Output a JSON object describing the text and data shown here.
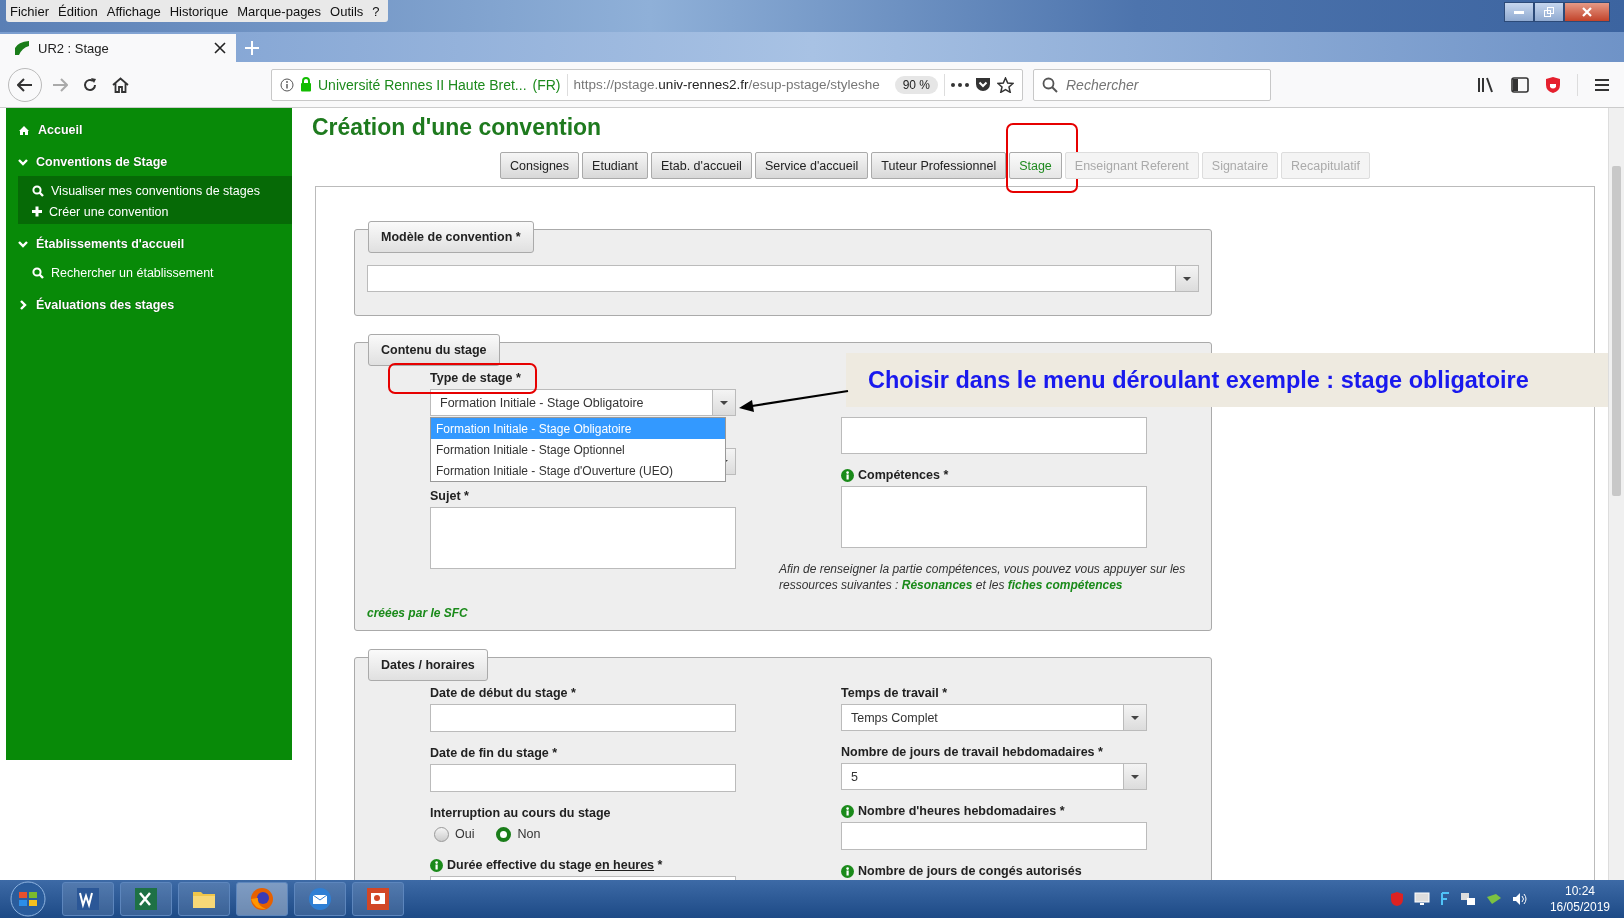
{
  "menu_bar": [
    "Fichier",
    "Édition",
    "Affichage",
    "Historique",
    "Marque-pages",
    "Outils",
    "?"
  ],
  "browser_tab": {
    "title": "UR2 : Stage"
  },
  "address_bar": {
    "site": "Université Rennes II Haute Bret...",
    "country": "(FR)",
    "url_prefix": "https://pstage.",
    "url_domain": "univ-rennes2.fr",
    "url_path": "/esup-pstage/styleshe",
    "zoom": "90 %"
  },
  "search": {
    "placeholder": "Rechercher"
  },
  "sidebar": {
    "items": [
      {
        "kind": "home",
        "label": "Accueil"
      },
      {
        "kind": "section",
        "label": "Conventions de Stage",
        "expanded": true,
        "selected": true,
        "children": [
          {
            "kind": "search",
            "label": "Visualiser mes conventions de stages"
          },
          {
            "kind": "add",
            "label": "Créer une convention"
          }
        ]
      },
      {
        "kind": "section",
        "label": "Établissements d'accueil",
        "expanded": true,
        "selected": false,
        "children": [
          {
            "kind": "search",
            "label": "Rechercher un établissement"
          }
        ]
      },
      {
        "kind": "section",
        "label": "Évaluations des stages",
        "expanded": false
      }
    ]
  },
  "page_title": "Création d'une convention",
  "tabs": [
    {
      "label": "Consignes",
      "selected": false,
      "disabled": false,
      "highlighted": false
    },
    {
      "label": "Etudiant",
      "selected": false,
      "disabled": false,
      "highlighted": false
    },
    {
      "label": "Etab. d'accueil",
      "selected": false,
      "disabled": false,
      "highlighted": false
    },
    {
      "label": "Service d'accueil",
      "selected": false,
      "disabled": false,
      "highlighted": false
    },
    {
      "label": "Tuteur Professionnel",
      "selected": false,
      "disabled": false,
      "highlighted": false
    },
    {
      "label": "Stage",
      "selected": true,
      "disabled": false,
      "highlighted": true
    },
    {
      "label": "Enseignant Referent",
      "selected": false,
      "disabled": true,
      "highlighted": false
    },
    {
      "label": "Signataire",
      "selected": false,
      "disabled": true,
      "highlighted": false
    },
    {
      "label": "Recapitulatif",
      "selected": false,
      "disabled": true,
      "highlighted": false
    }
  ],
  "sections": [
    {
      "legend": "Modèle de convention *",
      "fields": [
        {
          "kind": "select"
        }
      ]
    },
    {
      "legend": "Contenu du stage",
      "columns": [
        [
          {
            "kind": "select",
            "label": "Type de stage *",
            "highlighted": true,
            "value": "Formation Initiale - Stage Obligatoire",
            "open": true,
            "options": [
              {
                "label": "Formation Initiale - Stage Obligatoire",
                "selected": true
              },
              {
                "label": "Formation Initiale - Stage Optionnel",
                "selected": false
              },
              {
                "label": "Formation Initiale - Stage d'Ouverture (UEO)",
                "selected": false
              }
            ]
          },
          {
            "kind": "select"
          },
          {
            "kind": "textarea",
            "label": "Sujet *"
          }
        ],
        [
          {
            "kind": "textarea"
          },
          {
            "kind": "textarea",
            "label": "Compétences *",
            "info": true
          },
          {
            "kind": "help",
            "parts": [
              {
                "text": "Afin de renseigner la partie compétences, vous pouvez vous appuyer sur les ressources suivantes : ",
                "link": false
              },
              {
                "text": "Résonances",
                "link": true
              },
              {
                "text": " et les ",
                "link": false
              },
              {
                "text": "fiches compétences",
                "link": true
              }
            ]
          }
        ]
      ],
      "footer_link": "créées par le SFC"
    },
    {
      "legend": "Dates / horaires",
      "columns": [
        [
          {
            "kind": "text",
            "label": "Date de début du stage *"
          },
          {
            "kind": "text",
            "label": "Date de fin du stage *"
          },
          {
            "kind": "radio",
            "label": "Interruption au cours du stage",
            "options": [
              {
                "label": "Oui",
                "selected": false
              },
              {
                "label": "Non",
                "selected": true
              }
            ]
          },
          {
            "kind": "text",
            "label": "Durée effective du stage",
            "label_underlined": "en heures",
            "label_suffix": "*",
            "info": true
          }
        ],
        [
          {
            "kind": "select",
            "label": "Temps de travail *",
            "value": "Temps Complet"
          },
          {
            "kind": "select",
            "label": "Nombre de jours de travail hebdomadaires *",
            "value": "5"
          },
          {
            "kind": "text",
            "label": "Nombre d'heures hebdomadaires *",
            "info": true
          },
          {
            "kind": "text",
            "label": "Nombre de jours de congés autorisés",
            "info": true
          }
        ]
      ]
    }
  ],
  "annotation": {
    "text": "Choisir dans le menu déroulant exemple : stage obligatoire"
  },
  "taskbar": {
    "apps": [
      {
        "kind": "word",
        "selected": false
      },
      {
        "kind": "excel",
        "selected": false
      },
      {
        "kind": "explorer",
        "selected": false
      },
      {
        "kind": "firefox",
        "selected": true
      },
      {
        "kind": "mail",
        "selected": false
      },
      {
        "kind": "powerpoint",
        "selected": false
      }
    ],
    "time": "10:24",
    "date": "16/05/2019"
  }
}
